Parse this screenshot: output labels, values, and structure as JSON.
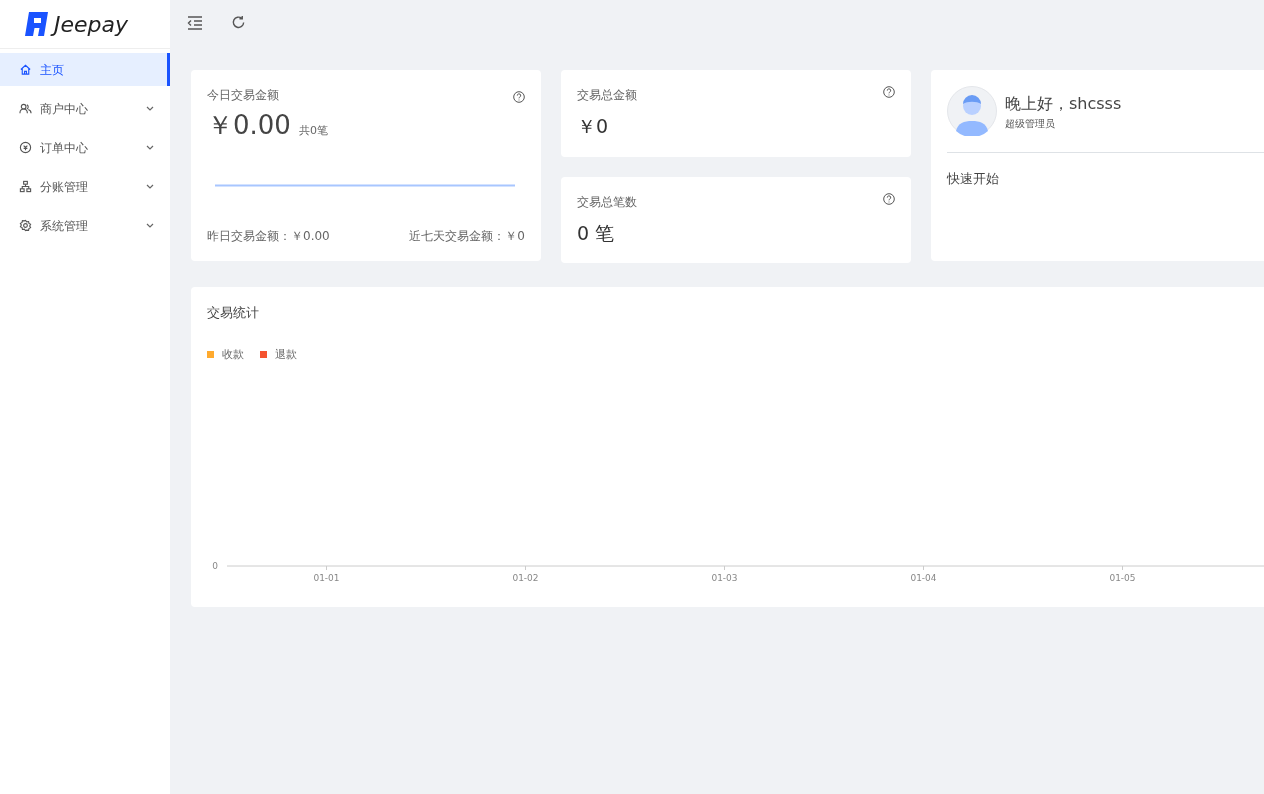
{
  "logo": {
    "text": "Jeepay"
  },
  "sidebar": {
    "items": [
      {
        "label": "主页",
        "kind": "home",
        "selected": true,
        "expandable": false
      },
      {
        "label": "商户中心",
        "kind": "users",
        "selected": false,
        "expandable": true
      },
      {
        "label": "订单中心",
        "kind": "order",
        "selected": false,
        "expandable": true
      },
      {
        "label": "分账管理",
        "kind": "cluster",
        "selected": false,
        "expandable": true
      },
      {
        "label": "系统管理",
        "kind": "gear",
        "selected": false,
        "expandable": true
      }
    ]
  },
  "today": {
    "title": "今日交易金额",
    "amount": "￥0.00",
    "count": "共0笔",
    "yesterday": "昨日交易金额：￥0.00",
    "week": "近七天交易金额：￥0"
  },
  "stats": [
    {
      "title": "交易总金额",
      "value": "￥0"
    },
    {
      "title": "交易总笔数",
      "value": "0 笔"
    }
  ],
  "user": {
    "greeting": "晚上好，shcsss",
    "role": "超级管理员",
    "quick_start": "快速开始"
  },
  "trade_stats": {
    "title": "交易统计",
    "legend": [
      {
        "name": "收款",
        "color": "#ffaa2e"
      },
      {
        "name": "退款",
        "color": "#f5532f"
      }
    ],
    "y_axis_label": "0",
    "x_axis_labels": [
      "01-01",
      "01-02",
      "01-03",
      "01-04",
      "01-05"
    ]
  }
}
